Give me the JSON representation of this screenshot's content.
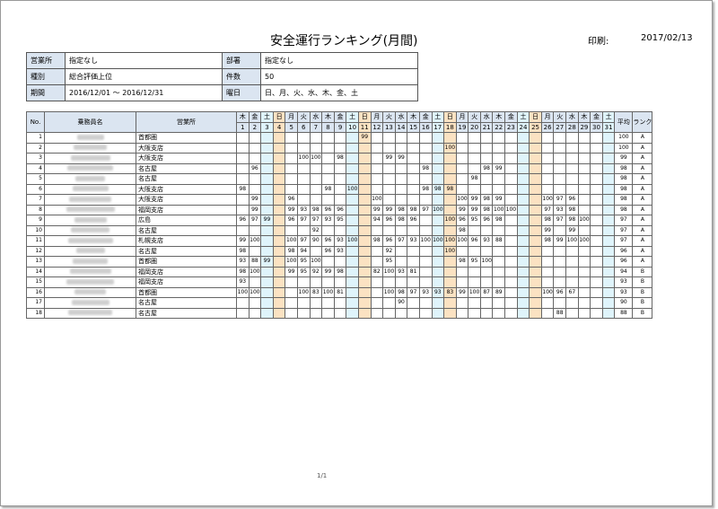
{
  "title": "安全運行ランキング(月間)",
  "print_label": "印刷:",
  "print_date": "2017/02/13",
  "meta": {
    "office_label": "営業所",
    "office_value": "指定なし",
    "dept_label": "部署",
    "dept_value": "指定なし",
    "type_label": "種別",
    "type_value": "総合評価上位",
    "count_label": "件数",
    "count_value": "50",
    "period_label": "期間",
    "period_value": "2016/12/01 〜 2016/12/31",
    "weekday_label": "曜日",
    "weekday_value": "日、月、火、水、木、金、土"
  },
  "grid": {
    "col_no": "No.",
    "col_name": "乗務員名",
    "col_office": "営業所",
    "col_avg": "平均",
    "col_rank": "ランク",
    "weekdays": [
      "木",
      "金",
      "土",
      "日",
      "月",
      "火",
      "水",
      "木",
      "金",
      "土",
      "日",
      "月",
      "火",
      "水",
      "木",
      "金",
      "土",
      "日",
      "月",
      "火",
      "水",
      "木",
      "金",
      "土",
      "日",
      "月",
      "火",
      "水",
      "木",
      "金",
      "土"
    ],
    "days": [
      "1",
      "2",
      "3",
      "4",
      "5",
      "6",
      "7",
      "8",
      "9",
      "10",
      "11",
      "12",
      "13",
      "14",
      "15",
      "16",
      "17",
      "18",
      "19",
      "20",
      "21",
      "22",
      "23",
      "24",
      "25",
      "26",
      "27",
      "28",
      "29",
      "30",
      "31"
    ],
    "rows": [
      {
        "no": "1",
        "office": "首都圏",
        "scores": {
          "11": "99"
        },
        "avg": "100",
        "rank": "A"
      },
      {
        "no": "2",
        "office": "大阪支店",
        "scores": {
          "18": "100"
        },
        "avg": "100",
        "rank": "A"
      },
      {
        "no": "3",
        "office": "大阪支店",
        "scores": {
          "6": "100",
          "7": "100",
          "9": "98",
          "13": "99",
          "14": "99"
        },
        "avg": "99",
        "rank": "A"
      },
      {
        "no": "4",
        "office": "名古屋",
        "scores": {
          "2": "96",
          "16": "98",
          "21": "98",
          "22": "99"
        },
        "avg": "98",
        "rank": "A"
      },
      {
        "no": "5",
        "office": "名古屋",
        "scores": {
          "20": "98"
        },
        "avg": "98",
        "rank": "A"
      },
      {
        "no": "6",
        "office": "大阪支店",
        "scores": {
          "1": "98",
          "8": "98",
          "10": "100",
          "16": "98",
          "17": "98",
          "18": "98"
        },
        "avg": "98",
        "rank": "A"
      },
      {
        "no": "7",
        "office": "大阪支店",
        "scores": {
          "2": "99",
          "5": "96",
          "12": "100",
          "19": "100",
          "20": "99",
          "21": "98",
          "22": "99",
          "26": "100",
          "27": "97",
          "28": "96"
        },
        "avg": "98",
        "rank": "A"
      },
      {
        "no": "8",
        "office": "福岡支店",
        "scores": {
          "2": "99",
          "5": "99",
          "6": "93",
          "7": "98",
          "8": "96",
          "9": "96",
          "12": "99",
          "13": "99",
          "14": "98",
          "15": "98",
          "16": "97",
          "17": "100",
          "19": "99",
          "20": "99",
          "21": "98",
          "22": "100",
          "23": "100",
          "26": "97",
          "27": "93",
          "28": "98"
        },
        "avg": "98",
        "rank": "A"
      },
      {
        "no": "9",
        "office": "広島",
        "scores": {
          "1": "96",
          "2": "97",
          "3": "99",
          "5": "96",
          "6": "97",
          "7": "97",
          "8": "93",
          "9": "95",
          "12": "94",
          "13": "96",
          "14": "98",
          "15": "96",
          "18": "100",
          "19": "96",
          "20": "95",
          "21": "96",
          "22": "98",
          "26": "98",
          "27": "97",
          "28": "98",
          "29": "100"
        },
        "avg": "97",
        "rank": "A"
      },
      {
        "no": "10",
        "office": "名古屋",
        "scores": {
          "7": "92",
          "19": "98",
          "26": "99",
          "28": "99"
        },
        "avg": "97",
        "rank": "A"
      },
      {
        "no": "11",
        "office": "札幌支店",
        "scores": {
          "1": "99",
          "2": "100",
          "5": "100",
          "6": "97",
          "7": "90",
          "8": "96",
          "9": "93",
          "10": "100",
          "12": "98",
          "13": "96",
          "14": "97",
          "15": "93",
          "16": "100",
          "17": "100",
          "18": "100",
          "19": "100",
          "20": "96",
          "21": "93",
          "22": "88",
          "26": "98",
          "27": "99",
          "28": "100",
          "29": "100"
        },
        "avg": "97",
        "rank": "A"
      },
      {
        "no": "12",
        "office": "名古屋",
        "scores": {
          "1": "98",
          "5": "98",
          "6": "94",
          "8": "96",
          "9": "93",
          "13": "92",
          "18": "100"
        },
        "avg": "96",
        "rank": "A"
      },
      {
        "no": "13",
        "office": "首都圏",
        "scores": {
          "1": "93",
          "2": "88",
          "3": "99",
          "5": "100",
          "6": "95",
          "7": "100",
          "13": "95",
          "19": "98",
          "20": "95",
          "21": "100"
        },
        "avg": "96",
        "rank": "A"
      },
      {
        "no": "14",
        "office": "福岡支店",
        "scores": {
          "1": "98",
          "2": "100",
          "5": "99",
          "6": "95",
          "7": "92",
          "8": "99",
          "9": "98",
          "12": "82",
          "13": "100",
          "14": "93",
          "15": "81"
        },
        "avg": "94",
        "rank": "B"
      },
      {
        "no": "15",
        "office": "福岡支店",
        "scores": {
          "1": "93"
        },
        "avg": "93",
        "rank": "B"
      },
      {
        "no": "16",
        "office": "首都圏",
        "scores": {
          "1": "100",
          "2": "100",
          "6": "100",
          "7": "83",
          "8": "100",
          "9": "81",
          "13": "100",
          "14": "98",
          "15": "97",
          "16": "93",
          "17": "93",
          "18": "83",
          "19": "99",
          "20": "100",
          "21": "87",
          "22": "89",
          "26": "100",
          "27": "96",
          "28": "67"
        },
        "avg": "93",
        "rank": "B"
      },
      {
        "no": "17",
        "office": "名古屋",
        "scores": {
          "14": "90"
        },
        "avg": "90",
        "rank": "B"
      },
      {
        "no": "18",
        "office": "名古屋",
        "scores": {
          "27": "88"
        },
        "avg": "88",
        "rank": "B"
      }
    ]
  },
  "footer": "1/1"
}
